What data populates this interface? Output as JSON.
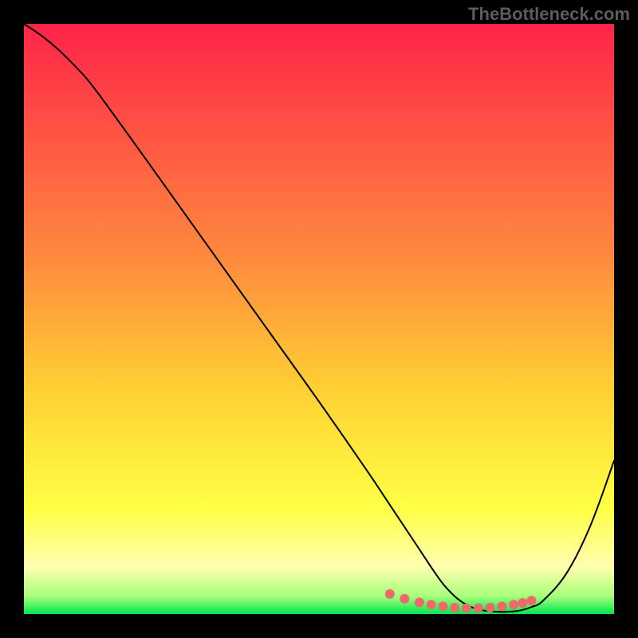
{
  "watermark": "TheBottleneck.com",
  "chart_data": {
    "type": "line",
    "title": "",
    "xlabel": "",
    "ylabel": "",
    "xlim": [
      0,
      100
    ],
    "ylim": [
      0,
      100
    ],
    "grid": false,
    "legend": false,
    "background_gradient": {
      "stops": [
        {
          "offset": 0,
          "color": "#ff2449"
        },
        {
          "offset": 40,
          "color": "#ff8b3e"
        },
        {
          "offset": 62,
          "color": "#ffd033"
        },
        {
          "offset": 82,
          "color": "#ffff44"
        },
        {
          "offset": 92,
          "color": "#ffffb0"
        },
        {
          "offset": 97,
          "color": "#a7ff7a"
        },
        {
          "offset": 100,
          "color": "#00e651"
        }
      ]
    },
    "series": [
      {
        "name": "curve",
        "color": "#000000",
        "stroke_width": 2,
        "x": [
          0,
          3,
          6,
          9,
          12,
          20,
          30,
          40,
          50,
          58,
          62,
          66,
          70,
          72,
          74,
          76,
          78,
          80,
          82,
          84,
          86,
          88,
          92,
          96,
          100
        ],
        "y": [
          100,
          98,
          95.5,
          92.5,
          89,
          78,
          64,
          50,
          36,
          24.5,
          18.5,
          12.5,
          6.5,
          4,
          2.2,
          1.1,
          0.6,
          0.4,
          0.4,
          0.6,
          1.2,
          2.3,
          7,
          15,
          26
        ]
      },
      {
        "name": "highlight_dots",
        "color": "#ee6a6a",
        "type": "scatter",
        "marker_size": 6,
        "x": [
          62,
          64.5,
          67,
          69,
          71,
          73,
          75,
          77,
          79,
          81,
          83,
          84.5,
          86
        ],
        "y": [
          3.4,
          2.6,
          2.0,
          1.6,
          1.3,
          1.1,
          1.0,
          1.0,
          1.1,
          1.3,
          1.6,
          1.9,
          2.3
        ]
      }
    ]
  }
}
